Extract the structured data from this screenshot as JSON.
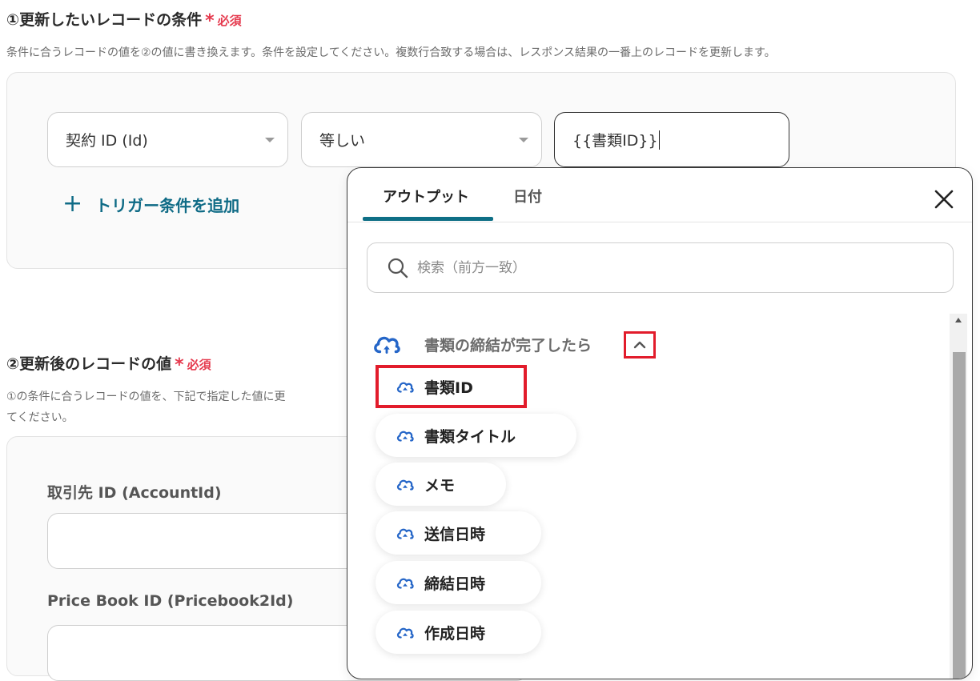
{
  "section1": {
    "title": "①更新したいレコードの条件",
    "required_mark": "*",
    "required_text": "必須",
    "description": "条件に合うレコードの値を②の値に書き換えます。条件を設定してください。複数行合致する場合は、レスポンス結果の一番上のレコードを更新します。",
    "field_select": "契約 ID (Id)",
    "operator_select": "等しい",
    "value_input": "{{書類ID}}",
    "add_condition": "トリガー条件を追加"
  },
  "section2": {
    "title": "②更新後のレコードの値",
    "required_mark": "*",
    "required_text": "必須",
    "description_line1": "①の条件に合うレコードの値を、下記で指定した値に更",
    "description_line2": "てください。",
    "fields": [
      {
        "label": "取引先 ID (AccountId)"
      },
      {
        "label": "Price Book ID (Pricebook2Id)"
      }
    ]
  },
  "popup": {
    "tabs": [
      {
        "label": "アウトプット",
        "active": true
      },
      {
        "label": "日付",
        "active": false
      }
    ],
    "search_placeholder": "検索（前方一致）",
    "group": {
      "label": "書類の締結が完了したら",
      "items": [
        {
          "label": "書類ID",
          "selected": true
        },
        {
          "label": "書類タイトル"
        },
        {
          "label": "メモ"
        },
        {
          "label": "送信日時"
        },
        {
          "label": "締結日時"
        },
        {
          "label": "作成日時"
        }
      ]
    }
  },
  "colors": {
    "accent": "#0e6f86",
    "required": "#e53a4e",
    "highlight": "#e21c2b",
    "icon_blue": "#2566c8"
  }
}
